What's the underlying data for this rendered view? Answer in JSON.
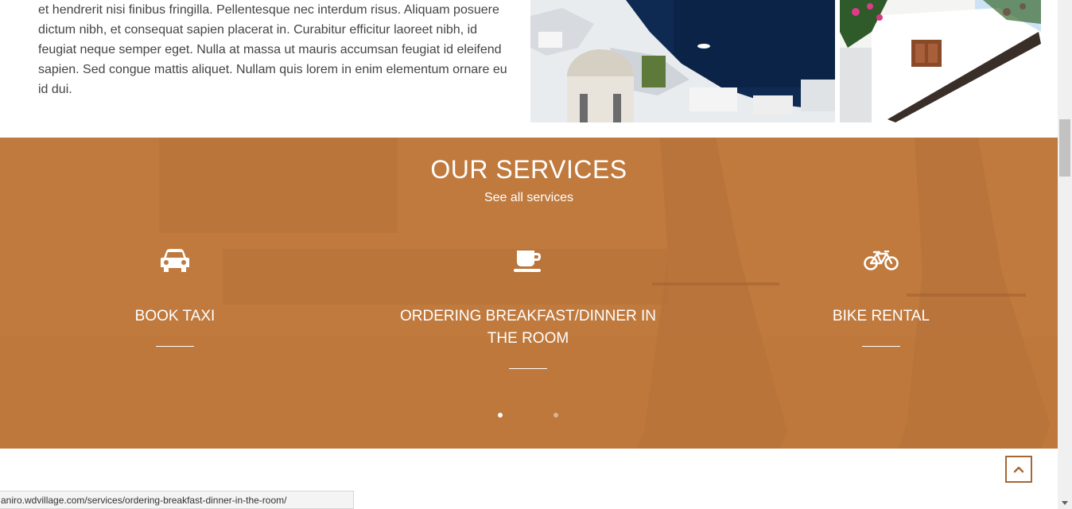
{
  "intro": {
    "paragraph": "et hendrerit nisi finibus fringilla. Pellentesque nec interdum risus. Aliquam posuere dictum nibh, et consequat sapien placerat in. Curabitur efficitur laoreet nibh, id feugiat neque semper eget. Nulla at massa ut mauris accumsan feugiat id eleifend sapien. Sed congue mattis aliquet. Nullam quis lorem in enim elementum ornare eu id dui."
  },
  "services": {
    "title": "OUR SERVICES",
    "see_all_label": "See all services",
    "items": [
      {
        "title": "BOOK TAXI",
        "icon": "car-icon"
      },
      {
        "title": "ORDERING BREAKFAST/DINNER IN THE ROOM",
        "icon": "coffee-cup-icon"
      },
      {
        "title": "BIKE RENTAL",
        "icon": "bicycle-icon"
      }
    ],
    "slider": {
      "total_dots": 2,
      "active_dot": 1
    }
  },
  "status_bar": {
    "url": "aniro.wdvillage.com/services/ordering-breakfast-dinner-in-the-room/"
  },
  "back_to_top": {
    "icon": "chevron-up-icon"
  },
  "colors": {
    "accent": "#c07a3e",
    "accent_border": "#a56734",
    "text": "#444444"
  }
}
